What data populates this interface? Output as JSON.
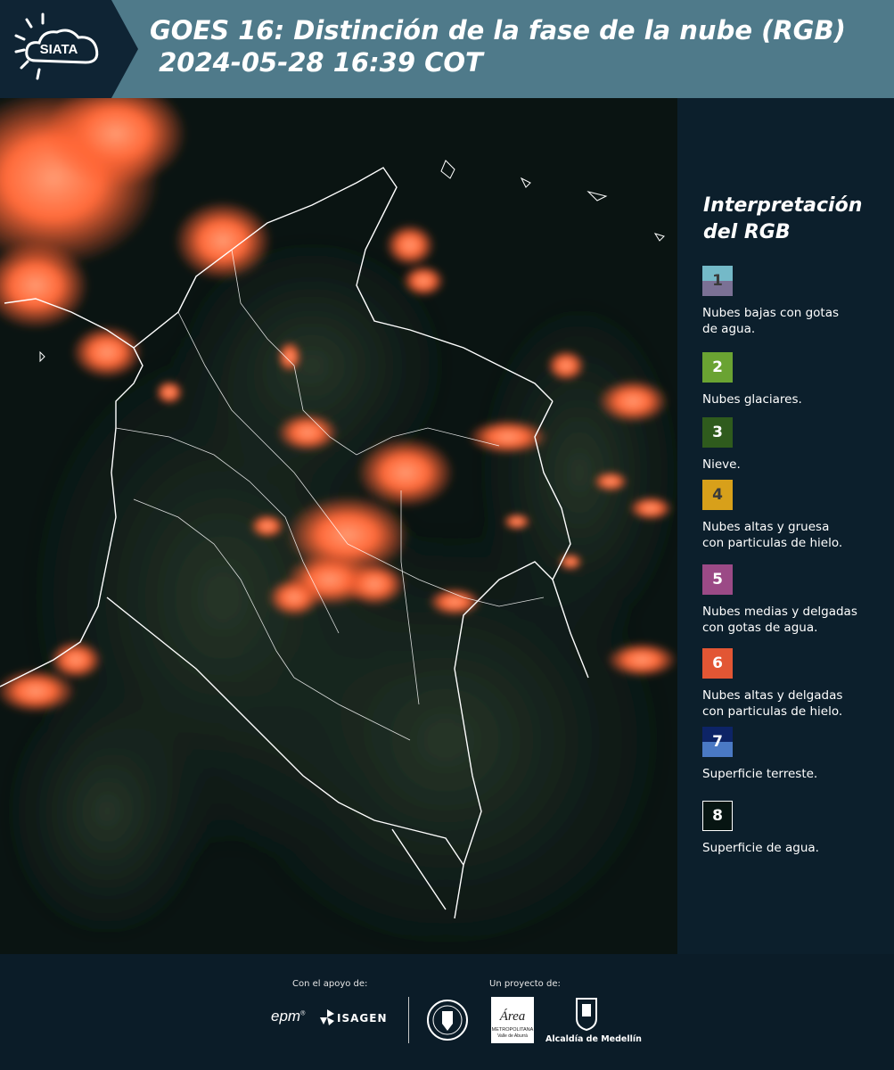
{
  "header": {
    "logo_text": "SIATA",
    "title_line1": "GOES 16: Distinción de la fase de la nube (RGB)",
    "title_line2": " 2024-05-28 16:39 COT"
  },
  "legend": {
    "title_line1": "Interpretación",
    "title_line2": "del RGB",
    "items": [
      {
        "num": "1",
        "desc_line1": "Nubes bajas con gotas",
        "desc_line2": "de agua.",
        "color_top": "#74b9c8",
        "color_bottom": "#7b7195"
      },
      {
        "num": "2",
        "desc_line1": "Nubes glaciares.",
        "desc_line2": "",
        "color_top": "#6aa332",
        "color_bottom": "#6aa332"
      },
      {
        "num": "3",
        "desc_line1": "Nieve.",
        "desc_line2": "",
        "color_top": "#2f5b1d",
        "color_bottom": "#2f5b1d"
      },
      {
        "num": "4",
        "desc_line1": "Nubes altas y gruesa",
        "desc_line2": "con particulas de hielo.",
        "color_top": "#d8a01a",
        "color_bottom": "#d8a01a"
      },
      {
        "num": "5",
        "desc_line1": "Nubes medias y delgadas",
        "desc_line2": "con gotas de agua.",
        "color_top": "#9b4a86",
        "color_bottom": "#9b4a86"
      },
      {
        "num": "6",
        "desc_line1": "Nubes altas y delgadas",
        "desc_line2": "con particulas de hielo.",
        "color_top": "#e25634",
        "color_bottom": "#e25634"
      },
      {
        "num": "7",
        "desc_line1": "Superficie terreste.",
        "desc_line2": "",
        "color_top": "#0d2466",
        "color_bottom": "#4a79c4"
      },
      {
        "num": "8",
        "desc_line1": "Superficie de agua.",
        "desc_line2": "",
        "color_top": "#071512",
        "color_bottom": "#071512"
      }
    ]
  },
  "footer": {
    "support_label": "Con el apoyo de:",
    "project_label": "Un proyecto de:",
    "epm": "epm",
    "isagen": "ISAGEN",
    "area_name": "Área",
    "area_sub1": "METROPOLITANA",
    "area_sub2": "Valle de Aburrá",
    "alcaldia": "Alcaldía de Medellín"
  },
  "colors": {
    "header_bg": "#4f7a8a",
    "panel_bg": "#0c1f2c",
    "cloud_orange": "#ff6a3a"
  }
}
